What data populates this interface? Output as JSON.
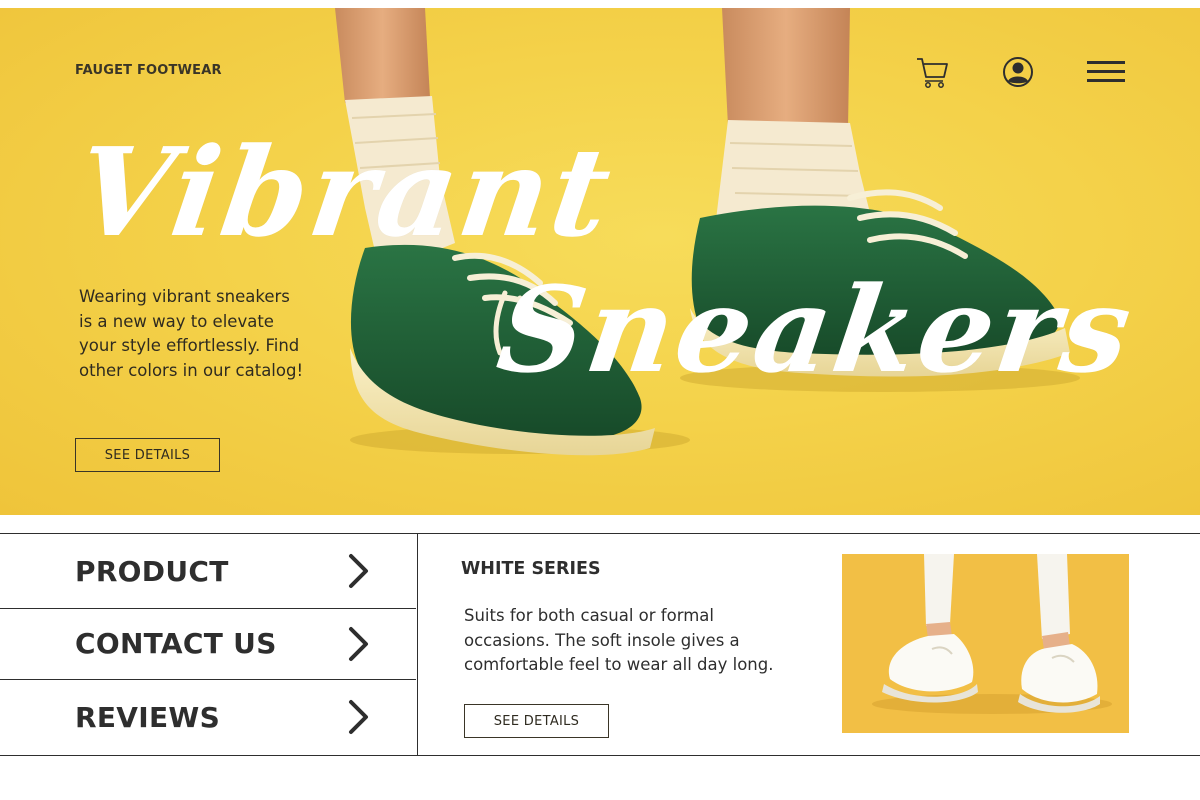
{
  "header": {
    "brand": "FAUGET FOOTWEAR",
    "icons": [
      "cart-icon",
      "user-icon",
      "menu-icon"
    ]
  },
  "hero": {
    "title_line1": "Vibrant",
    "title_line2": "Sneakers",
    "description": "Wearing vibrant sneakers is a new way to elevate your style effortlessly. Find other colors in our catalog!",
    "button_label": "SEE DETAILS",
    "background_color": "#f4d24a",
    "shoe_color": "#1f5e34"
  },
  "menu": {
    "items": [
      {
        "label": "PRODUCT"
      },
      {
        "label": "CONTACT US"
      },
      {
        "label": "REVIEWS"
      }
    ]
  },
  "series": {
    "title": "WHITE SERIES",
    "description": "Suits for both casual or formal occasions. The soft insole gives a comfortable feel to wear all day long.",
    "button_label": "SEE DETAILS",
    "photo_background": "#f2bf45"
  }
}
